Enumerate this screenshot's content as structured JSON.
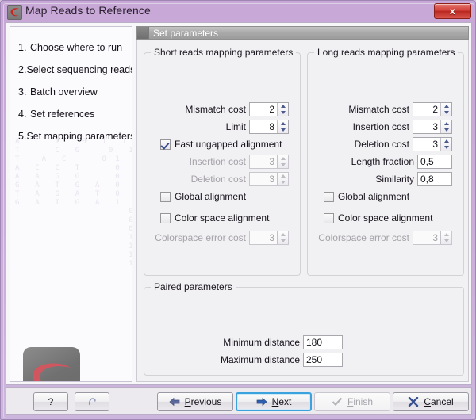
{
  "window": {
    "title": "Map Reads to Reference",
    "app_icon": "clc-logo-icon",
    "close_label": "x",
    "frame_color": "#c9acd8"
  },
  "sidebar": {
    "steps": [
      {
        "num": "1.",
        "label": "Choose where to run"
      },
      {
        "num": "2.",
        "label": "Select sequencing reads"
      },
      {
        "num": "3.",
        "label": "Batch overview"
      },
      {
        "num": "4.",
        "label": "Set references"
      },
      {
        "num": "5.",
        "label": "Set mapping parameters"
      }
    ],
    "watermark": "A  C  T   0  1  1\nT     C  G    0  1\nT   A  C     0 1   0\nA  C  C  T     0  0     1\nA  A  G  G     0  0     1\nG  A  T  G  A  0  1  1  0\nT  A  G  A  T  0  0  1  0\nG  A  T  G  A  1  0  1  1\n                 0  0  1\n                 0  0  0  0\n                 0  0  0  0\n                 1  0  0  1\n                 1  1  1  1\n                 1  0  1  0\n                 1  1  0  0",
    "logo_name": "clc-bio-logo"
  },
  "panel": {
    "header_title": "Set parameters",
    "short_group": {
      "title": "Short reads mapping parameters",
      "fields": [
        {
          "label": "Mismatch cost",
          "value": "2",
          "type": "spinner",
          "disabled": false
        },
        {
          "label": "Limit",
          "value": "8",
          "type": "spinner",
          "disabled": false
        },
        {
          "label": "Insertion cost",
          "value": "3",
          "type": "spinner",
          "disabled": true
        },
        {
          "label": "Deletion cost",
          "value": "3",
          "type": "spinner",
          "disabled": true
        },
        {
          "label": "Colorspace error cost",
          "value": "3",
          "type": "spinner",
          "disabled": true
        }
      ],
      "checkboxes": [
        {
          "label": "Fast ungapped alignment",
          "checked": true
        },
        {
          "label": "Global alignment",
          "checked": false
        },
        {
          "label": "Color space alignment",
          "checked": false
        }
      ]
    },
    "long_group": {
      "title": "Long reads mapping parameters",
      "fields": [
        {
          "label": "Mismatch cost",
          "value": "2",
          "type": "spinner",
          "disabled": false
        },
        {
          "label": "Insertion cost",
          "value": "3",
          "type": "spinner",
          "disabled": false
        },
        {
          "label": "Deletion cost",
          "value": "3",
          "type": "spinner",
          "disabled": false
        },
        {
          "label": "Length fraction",
          "value": "0,5",
          "type": "text",
          "disabled": false
        },
        {
          "label": "Similarity",
          "value": "0,8",
          "type": "text",
          "disabled": false
        },
        {
          "label": "Colorspace error cost",
          "value": "3",
          "type": "spinner",
          "disabled": true
        }
      ],
      "checkboxes": [
        {
          "label": "Global alignment",
          "checked": false
        },
        {
          "label": "Color space alignment",
          "checked": false
        }
      ]
    },
    "paired_group": {
      "title": "Paired parameters",
      "fields": [
        {
          "label": "Minimum distance",
          "value": "180",
          "type": "text"
        },
        {
          "label": "Maximum distance",
          "value": "250",
          "type": "text"
        }
      ]
    }
  },
  "footer": {
    "help_label": "?",
    "reset_icon": "undo-arrow-icon",
    "previous": {
      "label": "Previous",
      "mnemonic": "P",
      "icon": "arrow-left-icon"
    },
    "next": {
      "label": "Next",
      "mnemonic": "N",
      "icon": "arrow-right-icon",
      "focused": true
    },
    "finish": {
      "label": "Finish",
      "mnemonic": "F",
      "icon": "check-icon",
      "disabled": true
    },
    "cancel": {
      "label": "Cancel",
      "mnemonic": "C",
      "icon": "x-icon"
    }
  }
}
